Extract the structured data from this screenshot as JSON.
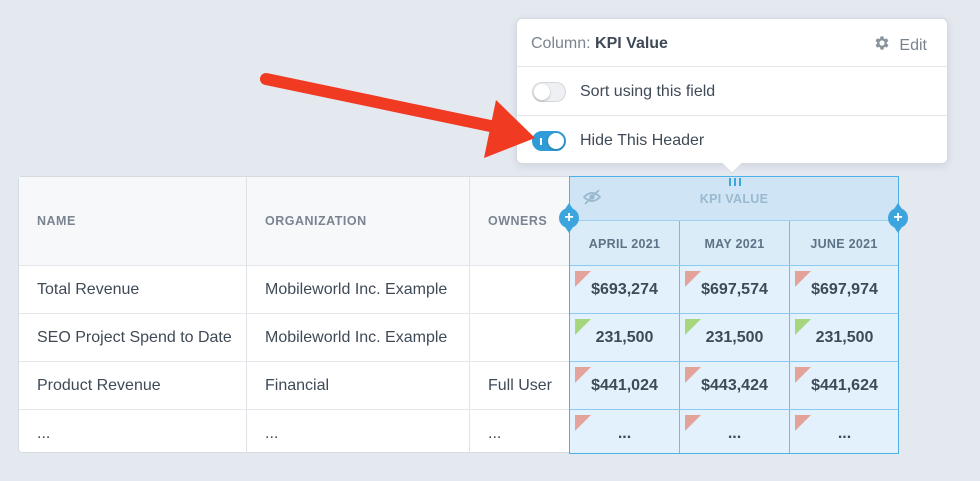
{
  "table": {
    "columns": [
      "NAME",
      "ORGANIZATION",
      "OWNERS"
    ],
    "rows": [
      {
        "name": "Total Revenue",
        "organization": "Mobileworld Inc. Example",
        "owners": ""
      },
      {
        "name": "SEO Project Spend to Date",
        "organization": "Mobileworld Inc. Example",
        "owners": ""
      },
      {
        "name": "Product Revenue",
        "organization": "Financial",
        "owners": "Full User"
      },
      {
        "name": "...",
        "organization": "...",
        "owners": "..."
      }
    ]
  },
  "kpi": {
    "group_title": "KPI VALUE",
    "months": [
      "APRIL 2021",
      "MAY 2021",
      "JUNE 2021"
    ],
    "rows": [
      {
        "values": [
          "$693,274",
          "$697,574",
          "$697,974"
        ],
        "status": [
          "red",
          "red",
          "red"
        ]
      },
      {
        "values": [
          "231,500",
          "231,500",
          "231,500"
        ],
        "status": [
          "green",
          "green",
          "green"
        ]
      },
      {
        "values": [
          "$441,024",
          "$443,424",
          "$441,624"
        ],
        "status": [
          "red",
          "red",
          "red"
        ]
      },
      {
        "values": [
          "...",
          "...",
          "..."
        ],
        "status": [
          "red",
          "red",
          "red"
        ]
      }
    ],
    "status_colors": {
      "red": "#e3a39a",
      "green": "#a6d67e"
    }
  },
  "popup": {
    "title_prefix": "Column:",
    "title_value": "KPI Value",
    "edit_label": "Edit",
    "sort_label": "Sort using this field",
    "sort_on": false,
    "hide_label": "Hide This Header",
    "hide_on": true
  },
  "colors": {
    "accent": "#3da5dd",
    "arrow": "#f03a22"
  }
}
